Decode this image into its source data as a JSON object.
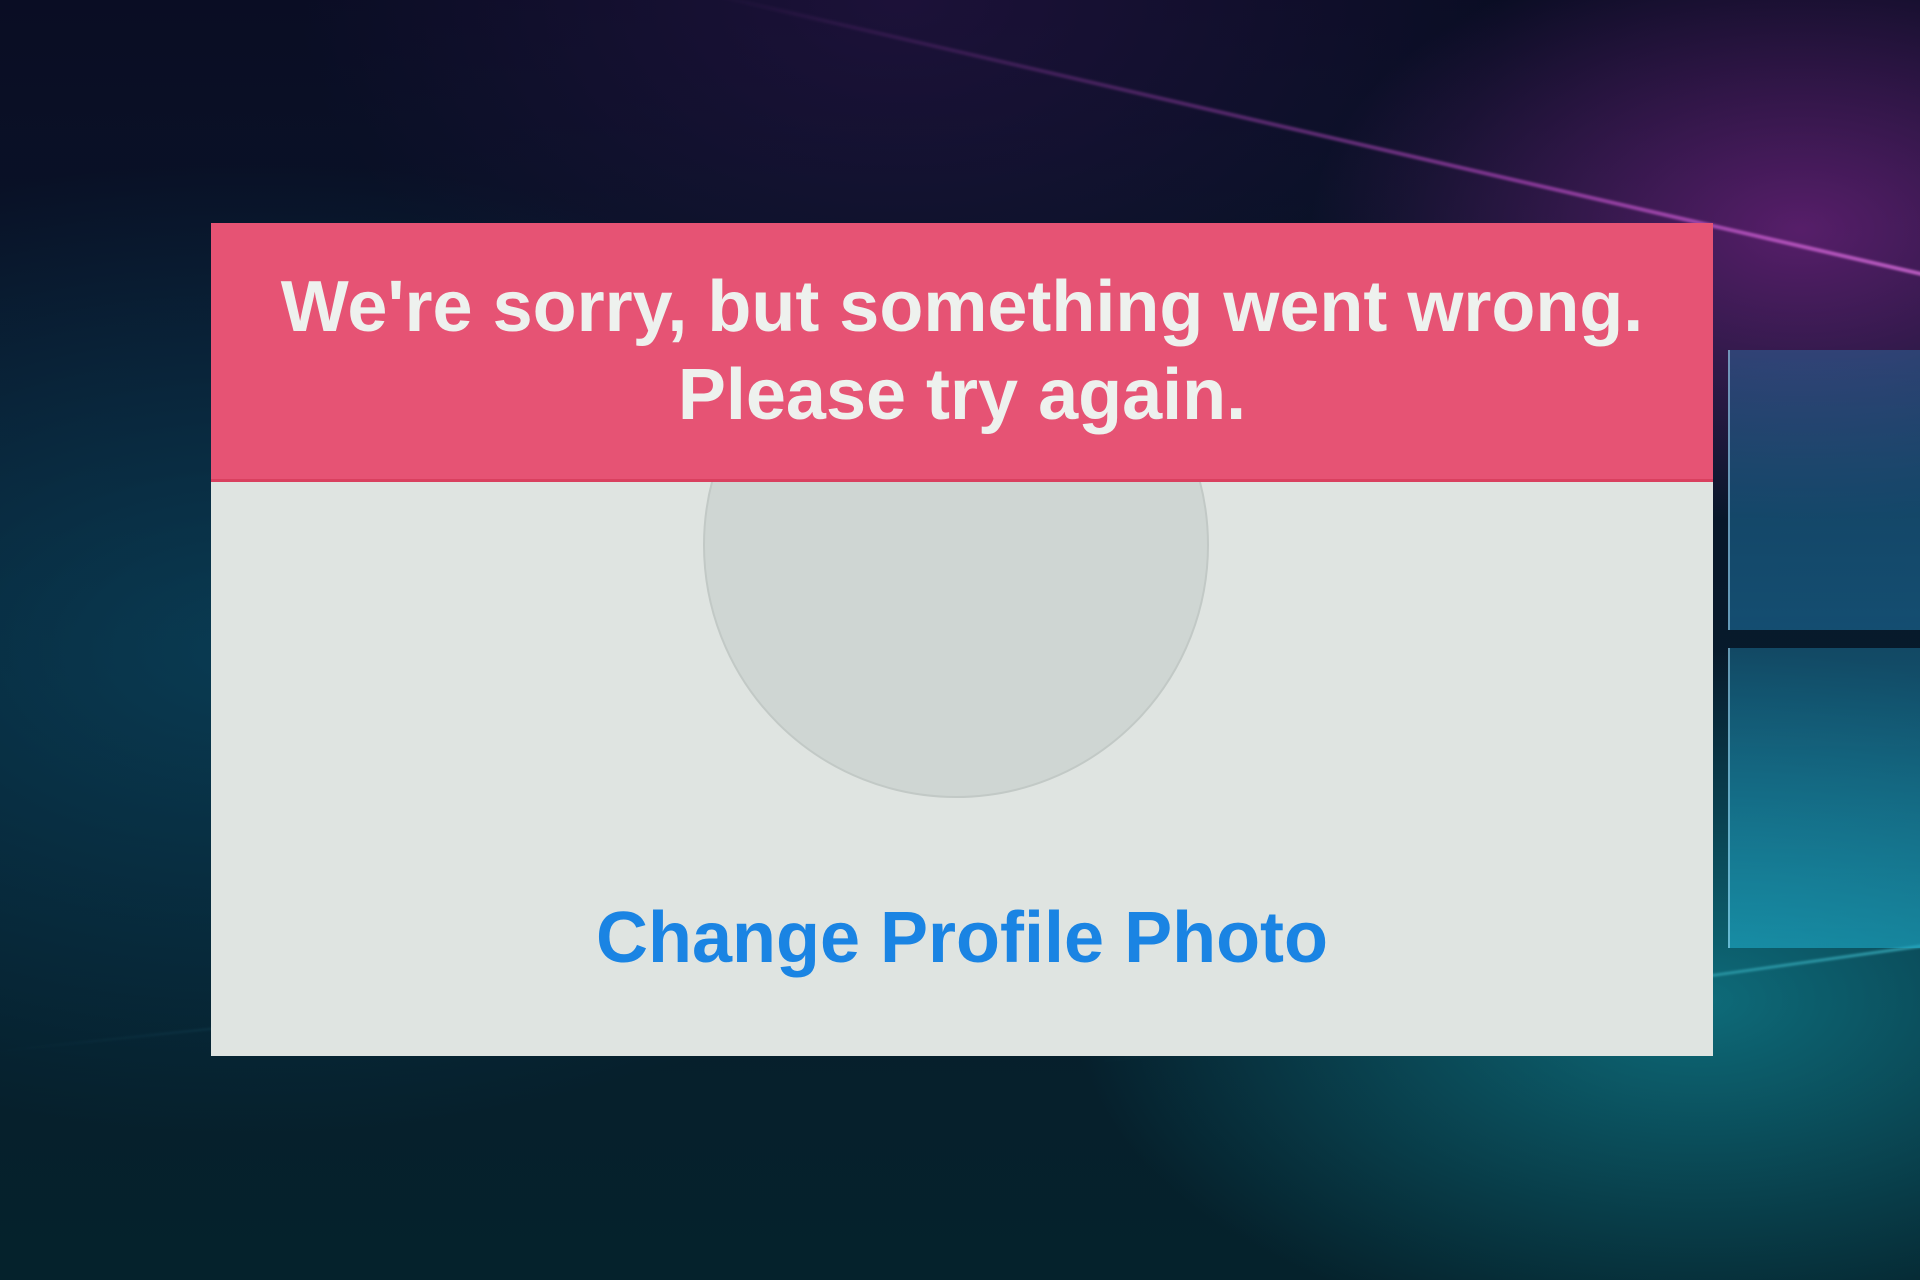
{
  "error_banner": {
    "line1": "We're sorry, but something went wrong.",
    "line2": "Please try again.",
    "color": "#e65374"
  },
  "profile": {
    "change_photo_label": "Change Profile Photo",
    "link_color": "#1a84e3"
  }
}
